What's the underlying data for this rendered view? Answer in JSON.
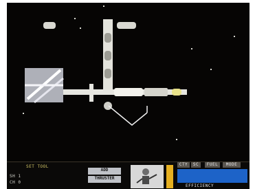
{
  "hud": {
    "set_label": "SET TOOL",
    "left_readout_1": "SH 1",
    "left_readout_2": "CH 0",
    "thruster_top": "ADD",
    "thruster_label": "THRUSTER",
    "tab_city": "CTY",
    "tab_sc": "SC",
    "tab_fuel": "FUEL",
    "tab_mode": "MODE",
    "info_lines": [
      "",
      ""
    ],
    "efficiency_label": "EFFICIENCY"
  },
  "colors": {
    "space": "#060504",
    "hud_bg": "#0a0908",
    "module_white": "#e6e6e0",
    "info_panel": "#1d63c8",
    "cursor_line": "#f0f0f0",
    "tab_bg": "#5a5650"
  },
  "icons": {
    "cursor": "pointer-lines",
    "astronaut": "astronaut-icon",
    "warning": "warning-stripe-icon"
  }
}
